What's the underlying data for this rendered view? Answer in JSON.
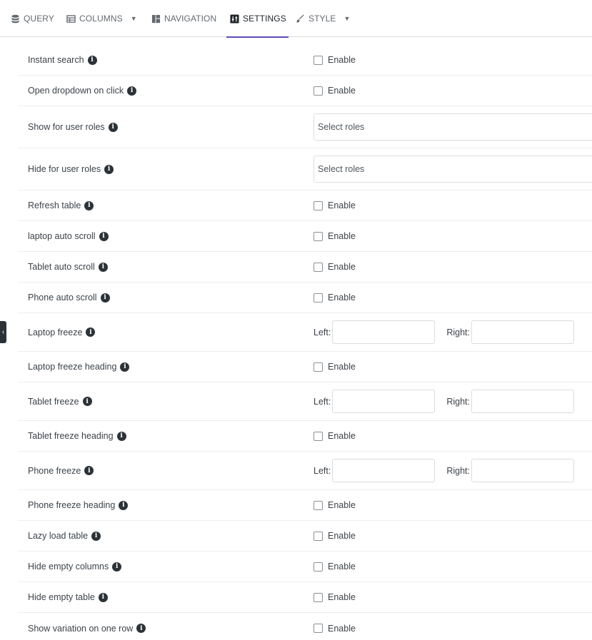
{
  "tabs": [
    {
      "label": "QUERY",
      "icon": "database-icon",
      "active": false
    },
    {
      "label": "COLUMNS",
      "icon": "table-icon",
      "active": false,
      "dropdown": true
    },
    {
      "label": "NAVIGATION",
      "icon": "layout-icon",
      "active": false
    },
    {
      "label": "SETTINGS",
      "icon": "sliders-icon",
      "active": true
    },
    {
      "label": "STYLE",
      "icon": "brush-icon",
      "active": false,
      "dropdown": true
    }
  ],
  "enable_label": "Enable",
  "select_placeholder": "Select roles",
  "left_label": "Left:",
  "right_label": "Right:",
  "settings": [
    {
      "label": "Instant search",
      "control": "checkbox"
    },
    {
      "label": "Open dropdown on click",
      "control": "checkbox"
    },
    {
      "label": "Show for user roles",
      "control": "select"
    },
    {
      "label": "Hide for user roles",
      "control": "select"
    },
    {
      "label": "Refresh table",
      "control": "checkbox"
    },
    {
      "label": "laptop auto scroll",
      "control": "checkbox"
    },
    {
      "label": "Tablet auto scroll",
      "control": "checkbox"
    },
    {
      "label": "Phone auto scroll",
      "control": "checkbox"
    },
    {
      "label": "Laptop freeze",
      "control": "freeze"
    },
    {
      "label": "Laptop freeze heading",
      "control": "checkbox"
    },
    {
      "label": "Tablet freeze",
      "control": "freeze"
    },
    {
      "label": "Tablet freeze heading",
      "control": "checkbox"
    },
    {
      "label": "Phone freeze",
      "control": "freeze"
    },
    {
      "label": "Phone freeze heading",
      "control": "checkbox"
    },
    {
      "label": "Lazy load table",
      "control": "checkbox"
    },
    {
      "label": "Hide empty columns",
      "control": "checkbox"
    },
    {
      "label": "Hide empty table",
      "control": "checkbox"
    },
    {
      "label": "Show variation on one row",
      "control": "checkbox"
    }
  ],
  "colors": {
    "accent": "#5b4bb7",
    "text": "#3c434a",
    "border": "#dcdcde"
  }
}
